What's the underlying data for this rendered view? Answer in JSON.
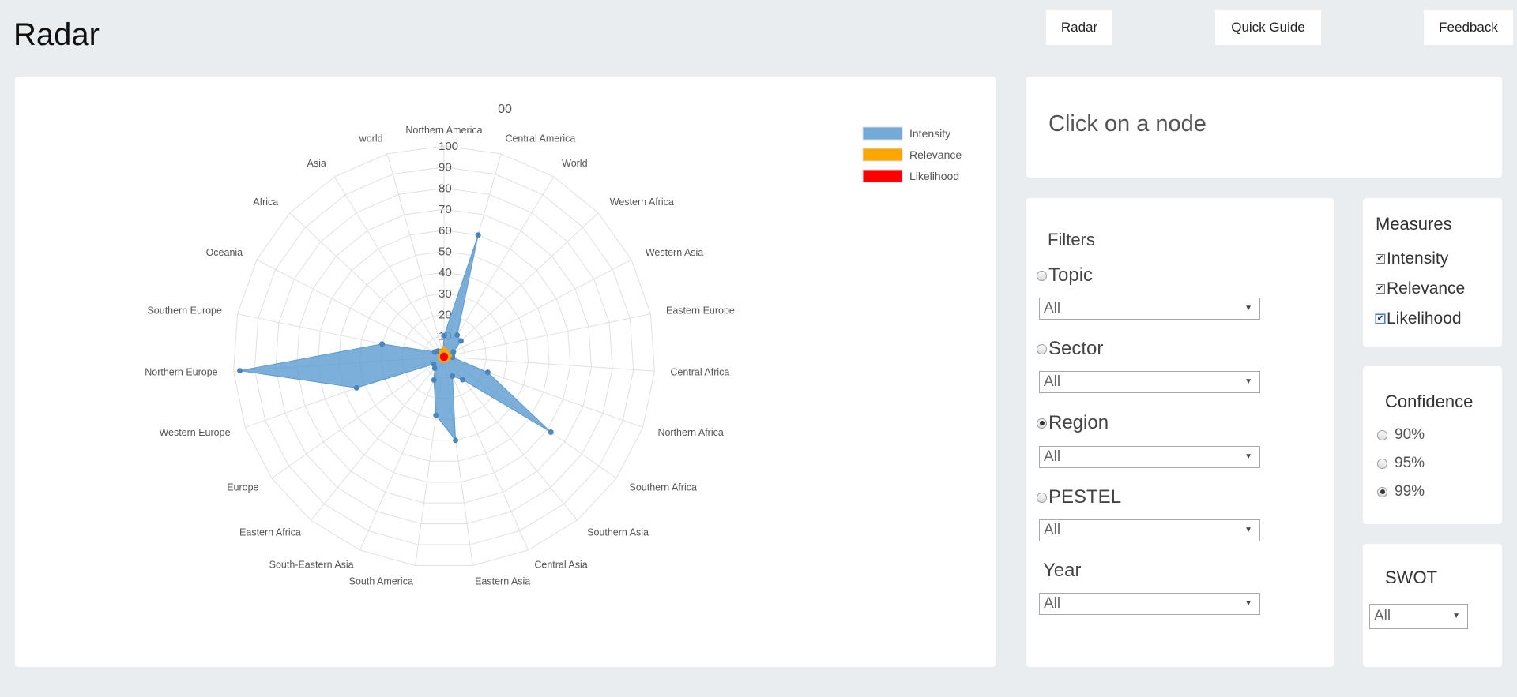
{
  "page": {
    "title": "Radar"
  },
  "nav": {
    "radar_label": "Radar",
    "quick_guide_label": "Quick Guide",
    "feedback_label": "Feedback"
  },
  "node_panel": {
    "text": "Click on a node"
  },
  "filters": {
    "title": "Filters",
    "topic": {
      "label": "Topic",
      "selected": false,
      "value": "All"
    },
    "sector": {
      "label": "Sector",
      "selected": false,
      "value": "All"
    },
    "region": {
      "label": "Region",
      "selected": true,
      "value": "All"
    },
    "pestel": {
      "label": "PESTEL",
      "selected": false,
      "value": "All"
    },
    "year": {
      "label": "Year",
      "value": "All"
    }
  },
  "measures": {
    "title": "Measures",
    "items": [
      {
        "label": "Intensity",
        "checked": true
      },
      {
        "label": "Relevance",
        "checked": true
      },
      {
        "label": "Likelihood",
        "checked": true
      }
    ]
  },
  "confidence": {
    "title": "Confidence",
    "options": [
      {
        "label": "90%",
        "selected": false
      },
      {
        "label": "95%",
        "selected": false
      },
      {
        "label": "99%",
        "selected": true
      }
    ]
  },
  "swot": {
    "title": "SWOT",
    "value": "All"
  },
  "colors": {
    "intensity": "#5b9bd1",
    "relevance": "#ffa500",
    "likelihood": "#ff0000",
    "grid": "#e0e0e0"
  },
  "chart_data": {
    "type": "radar",
    "title": "00",
    "ylim": [
      0,
      100
    ],
    "ticks": [
      10,
      20,
      30,
      40,
      50,
      60,
      70,
      80,
      90,
      100
    ],
    "grid": true,
    "legend": "top-right",
    "categories": [
      "Northern America",
      "Central America",
      "World",
      "Western Africa",
      "Western Asia",
      "Eastern Europe",
      "Central Africa",
      "Northern Africa",
      "Southern Africa",
      "Southern Asia",
      "Central Asia",
      "Eastern Asia",
      "South America",
      "South-Eastern Asia",
      "Eastern Africa",
      "Europe",
      "Western Europe",
      "Northern Europe",
      "Southern Europe",
      "Oceania",
      "Africa",
      "Asia",
      "world"
    ],
    "series": [
      {
        "name": "Intensity",
        "values": [
          10,
          60,
          12,
          11,
          5,
          4,
          4,
          22,
          62,
          14,
          10,
          40,
          28,
          12,
          7,
          6,
          44,
          97,
          30,
          5,
          4,
          3,
          2
        ]
      },
      {
        "name": "Relevance",
        "values": [
          4,
          3,
          3,
          2,
          2,
          3,
          2,
          2,
          2,
          2,
          2,
          2,
          2,
          2,
          2,
          2,
          2,
          2,
          2,
          2,
          2,
          3,
          3
        ]
      },
      {
        "name": "Likelihood",
        "values": [
          1,
          1,
          1,
          1,
          1,
          1,
          1,
          1,
          1,
          1,
          1,
          1,
          1,
          1,
          1,
          1,
          1,
          1,
          1,
          1,
          1,
          1,
          1
        ]
      }
    ]
  }
}
